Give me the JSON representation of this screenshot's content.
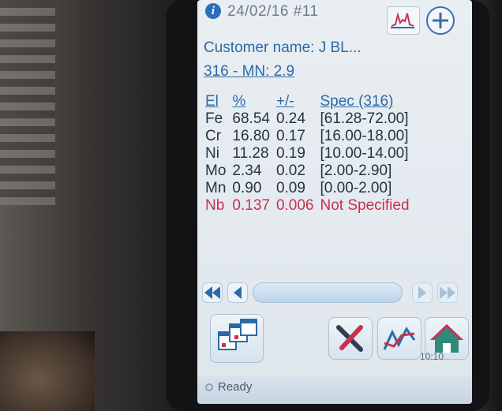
{
  "header": {
    "info_icon": "info-icon",
    "test_info": "24/02/16 #11",
    "chart_icon": "spectrum-chart-icon",
    "add_icon": "plus-icon"
  },
  "customer": {
    "name_line": "Customer name: J BL...",
    "grade_line": "316 - MN: 2.9"
  },
  "results": {
    "headers": [
      "El",
      "%",
      "+/-",
      "Spec (316)"
    ],
    "rows": [
      {
        "el": "Fe",
        "pct": "68.54",
        "err": "0.24",
        "spec": "[61.28-72.00]"
      },
      {
        "el": "Cr",
        "pct": "16.80",
        "err": "0.17",
        "spec": "[16.00-18.00]"
      },
      {
        "el": "Ni",
        "pct": "11.28",
        "err": "0.19",
        "spec": "[10.00-14.00]"
      },
      {
        "el": "Mo",
        "pct": "2.34",
        "err": "0.02",
        "spec": "[2.00-2.90]"
      },
      {
        "el": "Mn",
        "pct": "0.90",
        "err": "0.09",
        "spec": "[0.00-2.00]"
      },
      {
        "el": "Nb",
        "pct": "0.137",
        "err": "0.006",
        "spec": "Not Specified"
      }
    ],
    "not_specified_color": "#c7324e"
  },
  "navigation": {
    "first_icon": "double-left-arrow-icon",
    "prev_icon": "left-arrow-icon",
    "next_icon": "right-arrow-icon",
    "last_icon": "double-right-arrow-icon"
  },
  "toolbar": {
    "layout_icon": "multi-window-icon",
    "tools_icon": "tools-icon",
    "trends_icon": "trend-icon",
    "home_icon": "home-icon",
    "time": "10:10"
  },
  "status": {
    "text": "Ready"
  },
  "colors": {
    "accent": "#2b6aa8",
    "screen_bg": "#e9eef2"
  }
}
